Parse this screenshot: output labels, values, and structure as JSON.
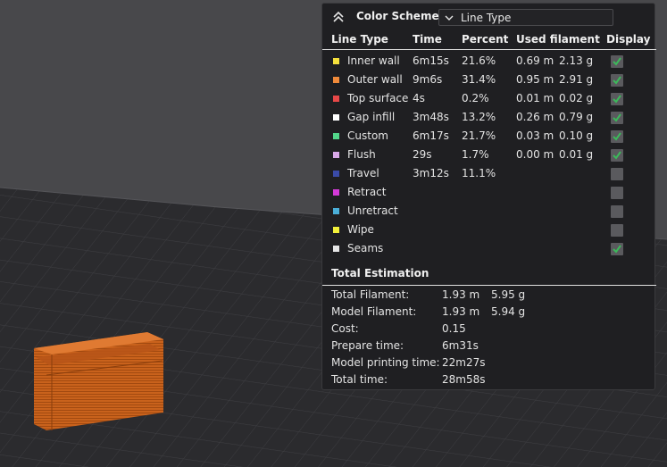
{
  "color_scheme": {
    "title": "Color Scheme",
    "selected": "Line Type"
  },
  "columns": [
    "Line Type",
    "Time",
    "Percent",
    "Used filament",
    "Display"
  ],
  "rows": [
    {
      "name": "Inner wall",
      "time": "6m15s",
      "percent": "21.6%",
      "length": "0.69 m",
      "weight": "2.13 g",
      "display": true,
      "color": "#f5e03c"
    },
    {
      "name": "Outer wall",
      "time": "9m6s",
      "percent": "31.4%",
      "length": "0.95 m",
      "weight": "2.91 g",
      "display": true,
      "color": "#f08a3a"
    },
    {
      "name": "Top surface",
      "time": "4s",
      "percent": "0.2%",
      "length": "0.01 m",
      "weight": "0.02 g",
      "display": true,
      "color": "#e84848"
    },
    {
      "name": "Gap infill",
      "time": "3m48s",
      "percent": "13.2%",
      "length": "0.26 m",
      "weight": "0.79 g",
      "display": true,
      "color": "#ffffff"
    },
    {
      "name": "Custom",
      "time": "6m17s",
      "percent": "21.7%",
      "length": "0.03 m",
      "weight": "0.10 g",
      "display": true,
      "color": "#52d68a"
    },
    {
      "name": "Flush",
      "time": "29s",
      "percent": "1.7%",
      "length": "0.00 m",
      "weight": "0.01 g",
      "display": true,
      "color": "#d8a8e8"
    },
    {
      "name": "Travel",
      "time": "3m12s",
      "percent": "11.1%",
      "length": "",
      "weight": "",
      "display": false,
      "color": "#3a4ba8"
    },
    {
      "name": "Retract",
      "time": "",
      "percent": "",
      "length": "",
      "weight": "",
      "display": false,
      "color": "#d43ad8"
    },
    {
      "name": "Unretract",
      "time": "",
      "percent": "",
      "length": "",
      "weight": "",
      "display": false,
      "color": "#4aaed8"
    },
    {
      "name": "Wipe",
      "time": "",
      "percent": "",
      "length": "",
      "weight": "",
      "display": false,
      "color": "#f2f03a"
    },
    {
      "name": "Seams",
      "time": "",
      "percent": "",
      "length": "",
      "weight": "",
      "display": true,
      "color": "#e6e6e6"
    }
  ],
  "total": {
    "title": "Total Estimation",
    "items": [
      {
        "label": "Total Filament:",
        "v1": "1.93 m",
        "v2": "5.95 g"
      },
      {
        "label": "Model Filament:",
        "v1": "1.93 m",
        "v2": "5.94 g"
      },
      {
        "label": "Cost:",
        "v1": "0.15",
        "v2": ""
      },
      {
        "label": "Prepare time:",
        "v1": "6m31s",
        "v2": ""
      },
      {
        "label": "Model printing time:",
        "v1": "22m27s",
        "v2": ""
      },
      {
        "label": "Total time:",
        "v1": "28m58s",
        "v2": ""
      }
    ]
  },
  "colors": {
    "panel_bg": "#1f1f22",
    "checkbox_check": "#3cb95a",
    "model": "#c8641e",
    "plate": "#2e2e31"
  }
}
